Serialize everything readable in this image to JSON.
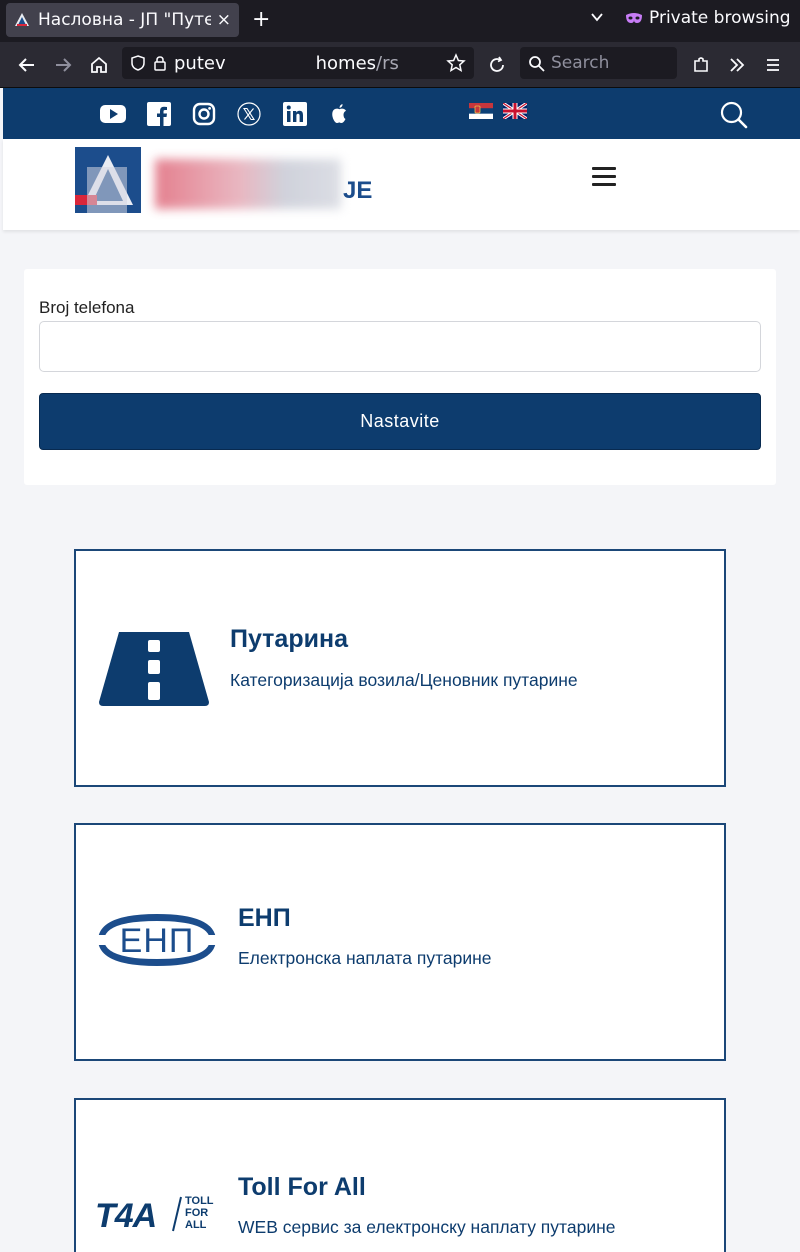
{
  "browser": {
    "tab_title": "Насловна - ЈП \"Путеви",
    "tab_close": "×",
    "new_tab": "+",
    "private_label": "Private browsing",
    "url_host": "putev",
    "url_path_main": "homes",
    "url_path_rest": "/rs",
    "search_placeholder": "Search"
  },
  "topbar": {
    "social_icons": [
      "youtube-icon",
      "facebook-icon",
      "instagram-icon",
      "x-icon",
      "linkedin-icon",
      "apple-icon"
    ],
    "languages": [
      "sr",
      "en"
    ],
    "brand_color": "#0d3c6e"
  },
  "header": {
    "logo_text_tail": "ЈЕ"
  },
  "form": {
    "phone_label": "Broj telefona",
    "phone_value": "",
    "submit_label": "Nastavite"
  },
  "services": [
    {
      "title": "Путарина",
      "description": "Категоризација возила/Ценовник путарине",
      "icon": "road-icon"
    },
    {
      "title": "ЕНП",
      "description": "Електронска наплата путарине",
      "icon": "enp-logo-icon"
    },
    {
      "title": "Toll For All",
      "description": "WEB сервис за електронску наплату путарине",
      "icon": "t4a-logo-icon",
      "logo_text": "T4A",
      "logo_subtext": [
        "TOLL",
        "FOR",
        "ALL"
      ]
    }
  ]
}
